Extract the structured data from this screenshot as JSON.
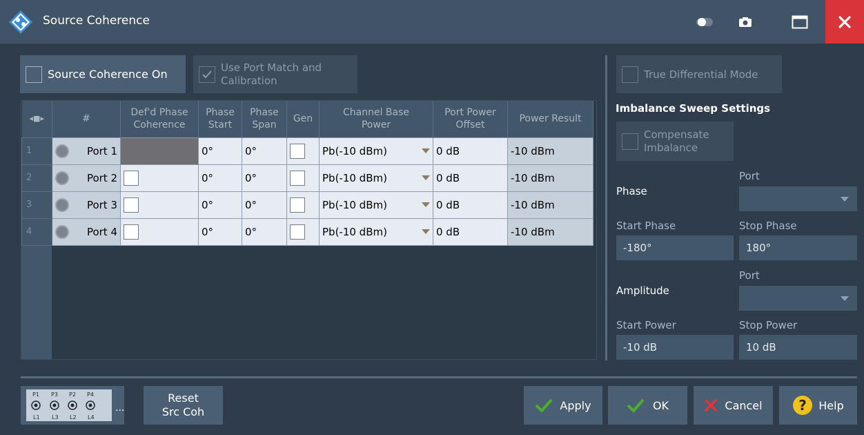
{
  "window": {
    "title": "Source Coherence"
  },
  "left_panel": {
    "source_coherence_on": "Source Coherence On",
    "use_port_match_line1": "Use Port Match and",
    "use_port_match_line2": "Calibration"
  },
  "table": {
    "headers": {
      "handle": "◂■▸",
      "number": "#",
      "defd_phase_1": "Def'd Phase",
      "defd_phase_2": "Coherence",
      "phase_start_1": "Phase",
      "phase_start_2": "Start",
      "phase_span_1": "Phase",
      "phase_span_2": "Span",
      "gen": "Gen",
      "channel_base_1": "Channel Base",
      "channel_base_2": "Power",
      "port_power_1": "Port Power",
      "port_power_2": "Offset",
      "power_result": "Power Result"
    },
    "rows": [
      {
        "num": "1",
        "port": "Port 1",
        "phase_start": "0°",
        "phase_span": "0°",
        "base_power": "Pb(-10 dBm)",
        "offset": "0 dB",
        "result": "-10 dBm"
      },
      {
        "num": "2",
        "port": "Port 2",
        "phase_start": "0°",
        "phase_span": "0°",
        "base_power": "Pb(-10 dBm)",
        "offset": "0 dB",
        "result": "-10 dBm"
      },
      {
        "num": "3",
        "port": "Port 3",
        "phase_start": "0°",
        "phase_span": "0°",
        "base_power": "Pb(-10 dBm)",
        "offset": "0 dB",
        "result": "-10 dBm"
      },
      {
        "num": "4",
        "port": "Port 4",
        "phase_start": "0°",
        "phase_span": "0°",
        "base_power": "Pb(-10 dBm)",
        "offset": "0 dB",
        "result": "-10 dBm"
      }
    ]
  },
  "right_panel": {
    "true_differential": "True Differential Mode",
    "imbalance_heading": "Imbalance Sweep Settings",
    "compensate_1": "Compensate",
    "compensate_2": "Imbalance",
    "phase_label": "Phase",
    "phase_port_label": "Port",
    "start_phase_label": "Start Phase",
    "stop_phase_label": "Stop Phase",
    "start_phase_value": "-180°",
    "stop_phase_value": "180°",
    "amplitude_label": "Amplitude",
    "amp_port_label": "Port",
    "start_power_label": "Start Power",
    "stop_power_label": "Stop Power",
    "start_power_value": "-10 dB",
    "stop_power_value": "10 dB"
  },
  "footer": {
    "port_top": [
      "P1",
      "P3",
      "P2",
      "P4"
    ],
    "port_bottom": [
      "L1",
      "L3",
      "L2",
      "L4"
    ],
    "ellipsis": "...",
    "reset_1": "Reset",
    "reset_2": "Src Coh",
    "apply": "Apply",
    "ok": "OK",
    "cancel": "Cancel",
    "help": "Help"
  },
  "colors": {
    "accent_check": "#4caf2a",
    "close_red": "#d8343a",
    "cancel_x": "#e0343a",
    "help_yellow": "#f3c21a"
  }
}
